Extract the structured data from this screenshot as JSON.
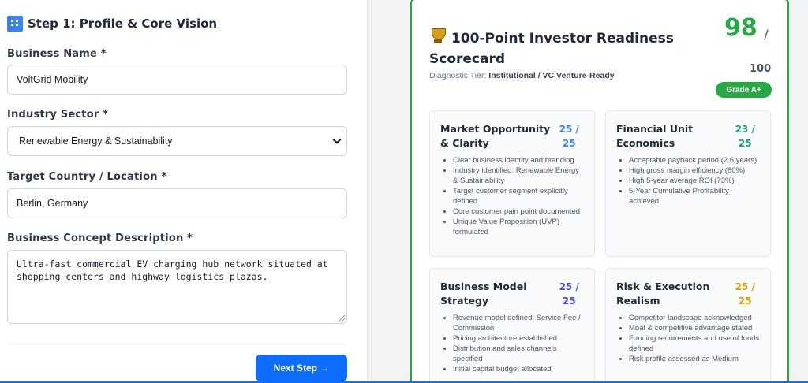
{
  "form": {
    "step_title": "Step 1: Profile & Core Vision",
    "business_name_label": "Business Name *",
    "business_name_value": "VoltGrid Mobility",
    "industry_label": "Industry Sector *",
    "industry_value": "Renewable Energy & Sustainability",
    "location_label": "Target Country / Location *",
    "location_value": "Berlin, Germany",
    "concept_label": "Business Concept Description *",
    "concept_value": "Ultra-fast commercial EV charging hub network situated at shopping centers and highway logistics plazas.",
    "next_button": "Next Step →"
  },
  "scorecard": {
    "title": "100-Point Investor Readiness Scorecard",
    "tier_label": "Diagnostic Tier:",
    "tier_value": "Institutional / VC Venture-Ready",
    "score": "98",
    "slash": "/",
    "total": "100",
    "grade": "Grade A+",
    "categories": [
      {
        "name": "Market Opportunity & Clarity",
        "score": "25 / 25",
        "items": [
          "Clear business identity and branding",
          "Industry identified: Renewable Energy & Sustainability",
          "Target customer segment explicitly defined",
          "Core customer pain point documented",
          "Unique Value Proposition (UVP) formulated"
        ]
      },
      {
        "name": "Financial Unit Economics",
        "score": "23 / 25",
        "items": [
          "Acceptable payback period (2.6 years)",
          "High gross margin efficiency (80%)",
          "High 5-year average ROI (73%)",
          "5-Year Cumulative Profitability achieved"
        ]
      },
      {
        "name": "Business Model Strategy",
        "score": "25 / 25",
        "items": [
          "Revenue model defined: Service Fee / Commission",
          "Pricing architecture established",
          "Distribution and sales channels specified",
          "Initial capital budget allocated"
        ]
      },
      {
        "name": "Risk & Execution Realism",
        "score": "25 / 25",
        "items": [
          "Competitor landscape acknowledged",
          "Moat & competitive advantage stated",
          "Funding requirements and use of funds defined",
          "Risk profile assessed as Medium"
        ]
      }
    ]
  },
  "colors": {
    "accent_green": "#28a745",
    "primary_blue": "#0d6efd"
  }
}
